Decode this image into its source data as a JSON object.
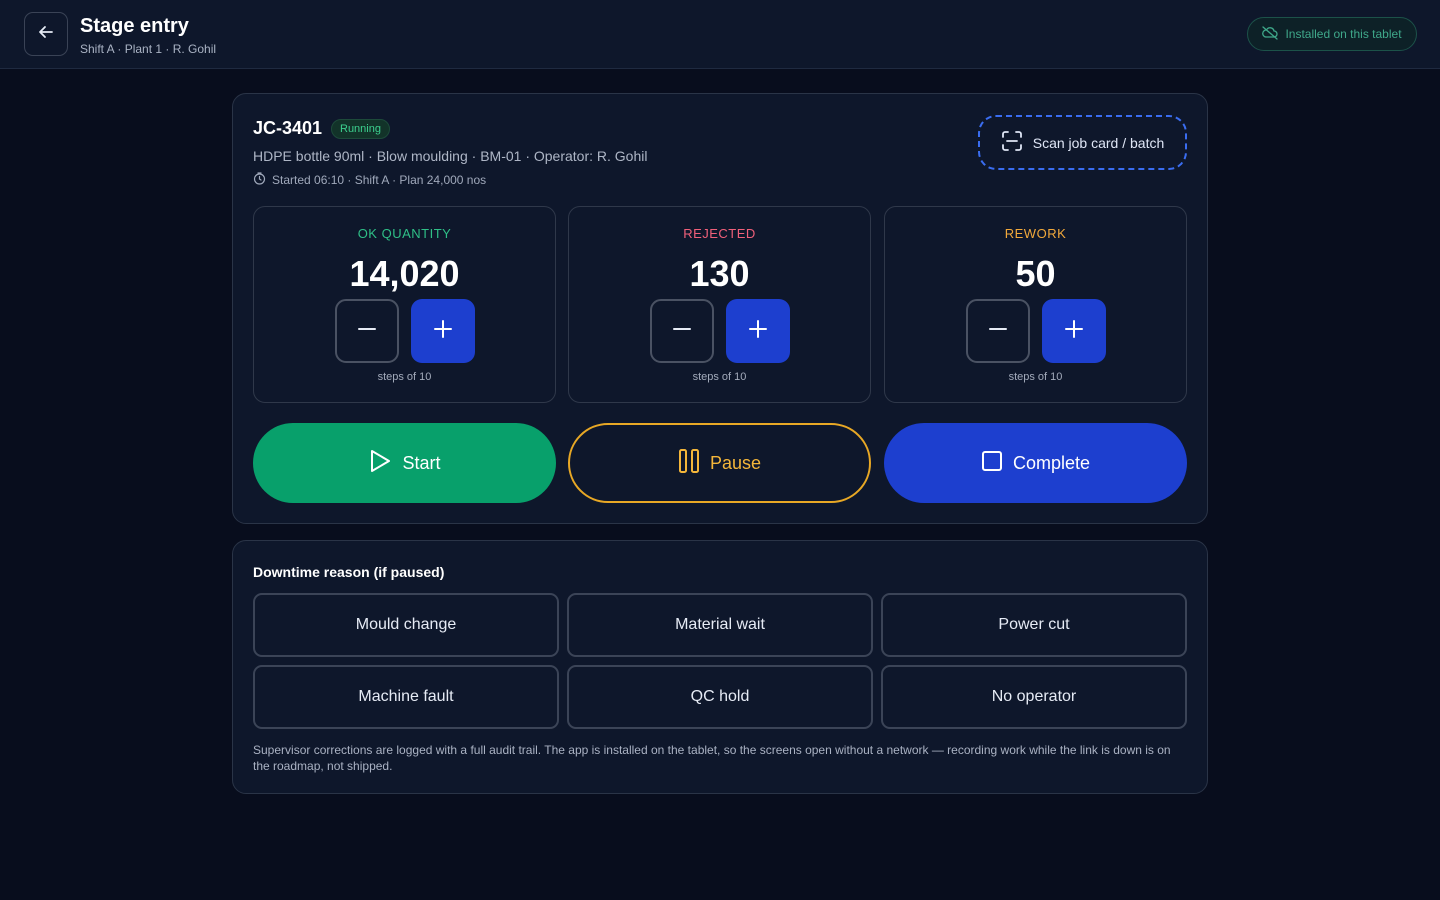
{
  "header": {
    "title": "Stage entry",
    "subtitle": "Shift A · Plant 1 · R. Gohil",
    "installed_label": "Installed on this tablet"
  },
  "job": {
    "id": "JC-3401",
    "status": "Running",
    "description": "HDPE bottle 90ml · Blow moulding · BM-01 · Operator: R. Gohil",
    "meta": "Started 06:10 · Shift A · Plan 24,000 nos",
    "scan_label": "Scan job card / batch"
  },
  "counters": [
    {
      "label": "OK QUANTITY",
      "value": "14,020",
      "steps": "steps of 10",
      "color": "#2fbf87"
    },
    {
      "label": "REJECTED",
      "value": "130",
      "steps": "steps of 10",
      "color": "#f0607a"
    },
    {
      "label": "REWORK",
      "value": "50",
      "steps": "steps of 10",
      "color": "#f2a93b"
    }
  ],
  "actions": {
    "start": "Start",
    "pause": "Pause",
    "complete": "Complete"
  },
  "downtime": {
    "title": "Downtime reason (if paused)",
    "reasons": [
      "Mould change",
      "Material wait",
      "Power cut",
      "Machine fault",
      "QC hold",
      "No operator"
    ],
    "footnote": "Supervisor corrections are logged with a full audit trail. The app is installed on the tablet, so the screens open without a network — recording work while the link is down is on the roadmap, not shipped."
  },
  "colors": {
    "accent_blue": "#1d3fcf",
    "start_green": "#08a06b",
    "pause_amber": "#e8a825",
    "status_green": "#3ccf8e"
  }
}
